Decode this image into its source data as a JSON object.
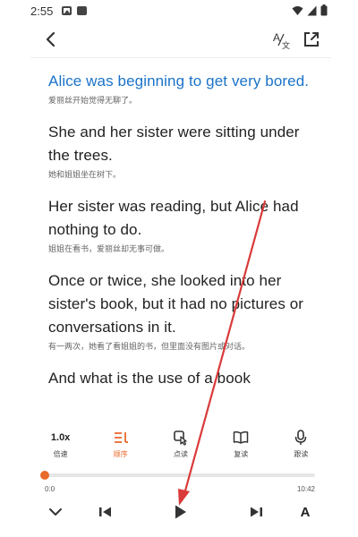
{
  "status_bar": {
    "time": "2:55"
  },
  "paragraphs": [
    {
      "en": "Alice was beginning to get very bored.",
      "zh": "爱丽丝开始觉得无聊了。",
      "active": true
    },
    {
      "en": "She and her sister were sitting under the trees.",
      "zh": "她和姐姐坐在树下。",
      "active": false
    },
    {
      "en": "Her sister was reading, but Alice had nothing to do.",
      "zh": "姐姐在看书，爱丽丝却无事可做。",
      "active": false
    },
    {
      "en": "Once or twice, she looked into her sister's book, but it had no pictures or conversations in it.",
      "zh": "有一两次，她看了看姐姐的书，但里面没有图片或对话。",
      "active": false
    },
    {
      "en": "And what is the use of a book",
      "zh": "",
      "active": false
    }
  ],
  "modes": [
    {
      "id": "speed",
      "top": "1.0x",
      "label": "倍速",
      "icon": "speed-text"
    },
    {
      "id": "order",
      "top": "",
      "label": "顺序",
      "icon": "sequence-icon",
      "selected": true
    },
    {
      "id": "tap-read",
      "top": "",
      "label": "点读",
      "icon": "tap-read-icon"
    },
    {
      "id": "repeat",
      "top": "",
      "label": "复读",
      "icon": "book-repeat-icon"
    },
    {
      "id": "follow-read",
      "top": "",
      "label": "跟读",
      "icon": "microphone-icon"
    }
  ],
  "player": {
    "time_start": "0:0",
    "time_end": "10:42",
    "progress": 0.0,
    "font_button": "A",
    "accent_color": "#e86a2c"
  },
  "annotation_color": "#d93a3a"
}
